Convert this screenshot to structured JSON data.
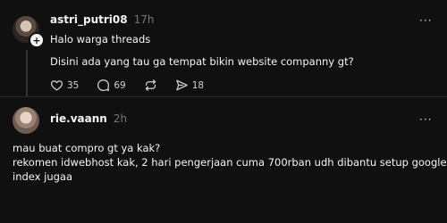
{
  "post": {
    "username": "astri_putri08",
    "time": "17h",
    "line1": "Halo warga threads",
    "line2": "Disini ada yang tau ga tempat bikin website companny gt?",
    "likes": "35",
    "comments": "69",
    "shares": "18",
    "more": "···"
  },
  "reply": {
    "username": "rie.vaann",
    "time": "2h",
    "line1": "mau buat compro gt ya kak?",
    "line2": "rekomen idwebhost kak, 2 hari pengerjaan cuma 700rban udh dibantu setup google",
    "line3": "index jugaa",
    "more": "···"
  },
  "icons": {
    "like": "heart-icon",
    "comment": "comment-bubble-icon",
    "repost": "repost-icon",
    "share": "send-icon",
    "follow": "plus-icon"
  }
}
